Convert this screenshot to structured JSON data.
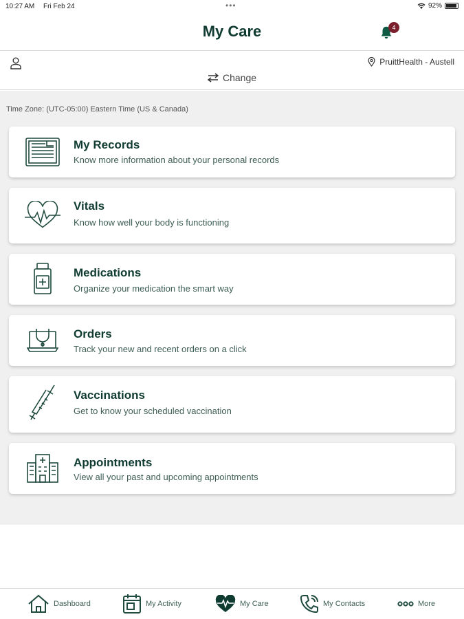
{
  "status_bar": {
    "time": "10:27 AM",
    "date": "Fri Feb 24",
    "battery": "92%",
    "battery_level": 0.92
  },
  "header": {
    "title": "My Care",
    "notification_count": "4"
  },
  "facility": {
    "location": "PruittHealth - Austell",
    "change_label": "Change"
  },
  "timezone": "Time Zone: (UTC-05:00) Eastern Time (US & Canada)",
  "cards": [
    {
      "title": "My Records",
      "description": "Know more information about your personal records",
      "icon": "records-icon"
    },
    {
      "title": "Vitals",
      "description": "Know how well your body is functioning",
      "icon": "heartbeat-icon"
    },
    {
      "title": "Medications",
      "description": "Organize your medication the smart way",
      "icon": "medicine-bottle-icon"
    },
    {
      "title": "Orders",
      "description": "Track your new and recent orders on a click",
      "icon": "laptop-stethoscope-icon"
    },
    {
      "title": "Vaccinations",
      "description": "Get to know your scheduled vaccination",
      "icon": "syringe-icon"
    },
    {
      "title": "Appointments",
      "description": "View all your past and upcoming appointments",
      "icon": "hospital-icon"
    }
  ],
  "bottom_nav": [
    {
      "label": "Dashboard",
      "icon": "home-icon"
    },
    {
      "label": "My Activity",
      "icon": "calendar-icon"
    },
    {
      "label": "My Care",
      "icon": "heart-pulse-icon"
    },
    {
      "label": "My Contacts",
      "icon": "phone-icon"
    },
    {
      "label": "More",
      "icon": "more-dots-icon"
    }
  ],
  "colors": {
    "brand": "#0f3b30",
    "badge": "#7a1f2b",
    "background": "#f0f0f0"
  }
}
